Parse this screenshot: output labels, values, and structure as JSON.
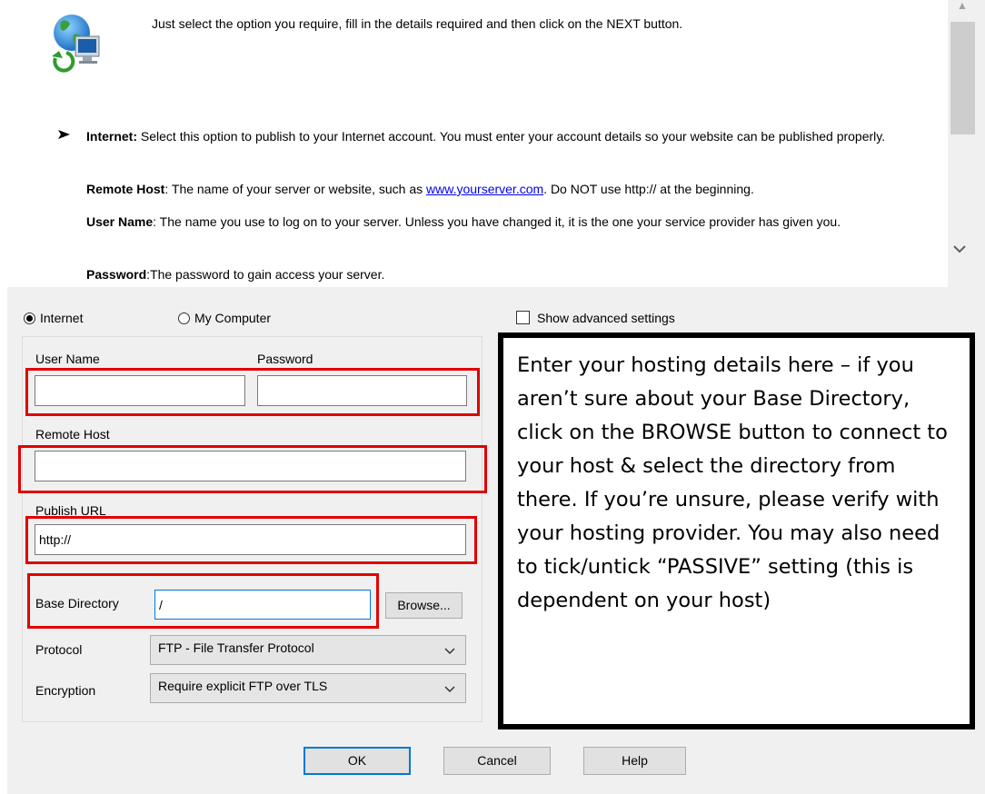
{
  "help": {
    "intro": "Just select the option you require, fill in the details required and then click on the NEXT button.",
    "internet_term": "Internet:",
    "internet_desc": " Select this option to publish to your Internet account. You must enter your account details so your website can be published properly.",
    "remote_host_term": "Remote Host",
    "remote_host_desc_1": ": The name of your server or website, such as ",
    "remote_host_link": "www.yourserver.com",
    "remote_host_desc_2": ". Do NOT use http:// at the beginning.",
    "user_name_term": "User Name",
    "user_name_desc": ": The name you use to log on to your server. Unless you have changed it, it is the one your service provider has given you.",
    "password_term": "Password",
    "password_desc": ":The password to gain access your server."
  },
  "mode": {
    "internet_label": "Internet",
    "my_computer_label": "My Computer",
    "selected": "Internet"
  },
  "advanced": {
    "label": "Show advanced settings",
    "checked": false
  },
  "form": {
    "user_name_label": "User Name",
    "user_name_value": "",
    "password_label": "Password",
    "password_value": "",
    "remote_host_label": "Remote Host",
    "remote_host_value": "",
    "publish_url_label": "Publish URL",
    "publish_url_value": "http://",
    "base_directory_label": "Base Directory",
    "base_directory_value": "/",
    "browse_label": "Browse...",
    "protocol_label": "Protocol",
    "protocol_value": "FTP - File Transfer Protocol",
    "encryption_label": "Encryption",
    "encryption_value": "Require explicit FTP over TLS"
  },
  "note": {
    "text": "Enter your hosting details here – if you aren’t sure about your Base Directory, click on the BROWSE button to connect to your host & select the directory from there. If you’re unsure, please verify with your hosting provider. You may also need to tick/untick “PASSIVE” setting (this is dependent on your host)"
  },
  "buttons": {
    "ok": "OK",
    "cancel": "Cancel",
    "help": "Help"
  },
  "colors": {
    "highlight_red": "#e00000",
    "focus_blue": "#0078d7",
    "dialog_bg": "#f0f0f0"
  },
  "icons": {
    "help_icon": "globe-computer-icon",
    "bullet": "arrow-bullet-icon"
  }
}
